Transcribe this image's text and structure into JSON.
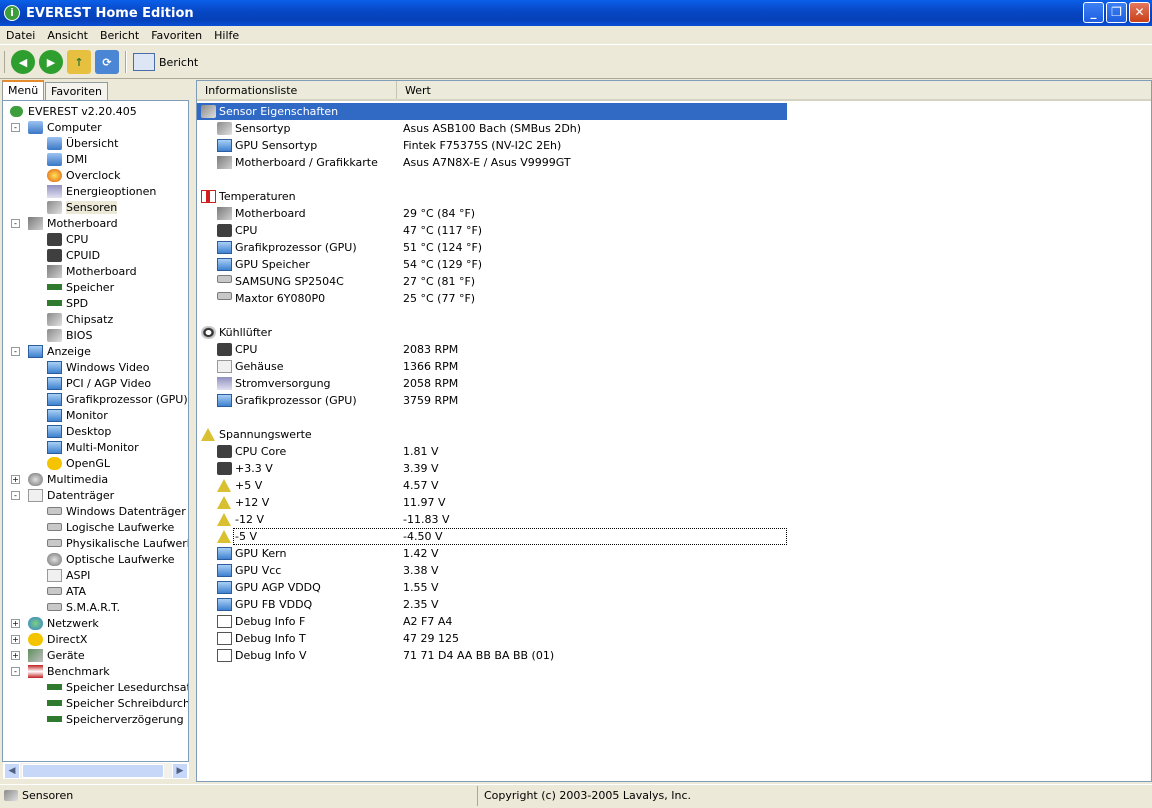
{
  "window": {
    "title": "EVEREST Home Edition"
  },
  "menu": [
    "Datei",
    "Ansicht",
    "Bericht",
    "Favoriten",
    "Hilfe"
  ],
  "toolbar": {
    "report_label": "Bericht"
  },
  "tabs": {
    "menu": "Menü",
    "favorites": "Favoriten"
  },
  "tree": [
    {
      "label": "EVEREST v2.20.405",
      "icon": "everest-icon",
      "level": 0
    },
    {
      "label": "Computer",
      "icon": "computer-icon",
      "level": 1,
      "expander": "-"
    },
    {
      "label": "Übersicht",
      "icon": "computer-icon",
      "level": 2
    },
    {
      "label": "DMI",
      "icon": "computer-icon",
      "level": 2
    },
    {
      "label": "Overclock",
      "icon": "fire-icon",
      "level": 2
    },
    {
      "label": "Energieoptionen",
      "icon": "power-icon",
      "level": 2
    },
    {
      "label": "Sensoren",
      "icon": "sensor-icon",
      "level": 2,
      "selected": true
    },
    {
      "label": "Motherboard",
      "icon": "motherboard-icon",
      "level": 1,
      "expander": "-"
    },
    {
      "label": "CPU",
      "icon": "cpu-icon",
      "level": 2
    },
    {
      "label": "CPUID",
      "icon": "cpu-icon",
      "level": 2
    },
    {
      "label": "Motherboard",
      "icon": "motherboard-icon",
      "level": 2
    },
    {
      "label": "Speicher",
      "icon": "memory-icon",
      "level": 2
    },
    {
      "label": "SPD",
      "icon": "memory-icon",
      "level": 2
    },
    {
      "label": "Chipsatz",
      "icon": "chipset-icon",
      "level": 2
    },
    {
      "label": "BIOS",
      "icon": "chipset-icon",
      "level": 2
    },
    {
      "label": "Anzeige",
      "icon": "monitor-icon",
      "level": 1,
      "expander": "-"
    },
    {
      "label": "Windows Video",
      "icon": "monitor-icon",
      "level": 2
    },
    {
      "label": "PCI / AGP Video",
      "icon": "monitor-icon",
      "level": 2
    },
    {
      "label": "Grafikprozessor (GPU)",
      "icon": "monitor-icon",
      "level": 2
    },
    {
      "label": "Monitor",
      "icon": "monitor-icon",
      "level": 2
    },
    {
      "label": "Desktop",
      "icon": "desktop-icon",
      "level": 2
    },
    {
      "label": "Multi-Monitor",
      "icon": "monitor-icon",
      "level": 2
    },
    {
      "label": "OpenGL",
      "icon": "opengl-icon",
      "level": 2
    },
    {
      "label": "Multimedia",
      "icon": "multimedia-icon",
      "level": 1,
      "expander": "+"
    },
    {
      "label": "Datenträger",
      "icon": "storage-icon",
      "level": 1,
      "expander": "-"
    },
    {
      "label": "Windows Datenträger",
      "icon": "disk-icon",
      "level": 2
    },
    {
      "label": "Logische Laufwerke",
      "icon": "disk-icon",
      "level": 2
    },
    {
      "label": "Physikalische Laufwerke",
      "icon": "disk-icon",
      "level": 2
    },
    {
      "label": "Optische Laufwerke",
      "icon": "optical-icon",
      "level": 2
    },
    {
      "label": "ASPI",
      "icon": "aspi-icon",
      "level": 2
    },
    {
      "label": "ATA",
      "icon": "disk-icon",
      "level": 2
    },
    {
      "label": "S.M.A.R.T.",
      "icon": "disk-icon",
      "level": 2
    },
    {
      "label": "Netzwerk",
      "icon": "network-icon",
      "level": 1,
      "expander": "+"
    },
    {
      "label": "DirectX",
      "icon": "directx-icon",
      "level": 1,
      "expander": "+"
    },
    {
      "label": "Geräte",
      "icon": "devices-icon",
      "level": 1,
      "expander": "+"
    },
    {
      "label": "Benchmark",
      "icon": "hourglass-icon",
      "level": 1,
      "expander": "-"
    },
    {
      "label": "Speicher Lesedurchsatz",
      "icon": "memory-icon",
      "level": 2
    },
    {
      "label": "Speicher Schreibdurchsat",
      "icon": "memory-icon",
      "level": 2
    },
    {
      "label": "Speicherverzögerung",
      "icon": "memory-icon",
      "level": 2
    }
  ],
  "list": {
    "columns": [
      "Informationsliste",
      "Wert"
    ],
    "rows": [
      {
        "label": "Sensor Eigenschaften",
        "value": "",
        "icon": "sensor-icon",
        "group": true,
        "highlight": true
      },
      {
        "label": "Sensortyp",
        "value": "Asus ASB100 Bach  (SMBus 2Dh)",
        "icon": "sensor-icon"
      },
      {
        "label": "GPU Sensortyp",
        "value": "Fintek F75375S  (NV-I2C 2Eh)",
        "icon": "monitor-icon"
      },
      {
        "label": "Motherboard / Grafikkarte",
        "value": "Asus A7N8X-E / Asus V9999GT",
        "icon": "motherboard-icon"
      },
      {
        "label": "",
        "value": "",
        "spacer": true
      },
      {
        "label": "Temperaturen",
        "value": "",
        "icon": "thermometer-icon",
        "group": true
      },
      {
        "label": "Motherboard",
        "value": "29 °C  (84 °F)",
        "icon": "motherboard-icon"
      },
      {
        "label": "CPU",
        "value": "47 °C  (117 °F)",
        "icon": "cpu-icon"
      },
      {
        "label": "Grafikprozessor (GPU)",
        "value": "51 °C  (124 °F)",
        "icon": "monitor-icon"
      },
      {
        "label": "GPU Speicher",
        "value": "54 °C  (129 °F)",
        "icon": "monitor-icon"
      },
      {
        "label": "SAMSUNG SP2504C",
        "value": "27 °C  (81 °F)",
        "icon": "disk-icon"
      },
      {
        "label": "Maxtor 6Y080P0",
        "value": "25 °C  (77 °F)",
        "icon": "disk-icon"
      },
      {
        "label": "",
        "value": "",
        "spacer": true
      },
      {
        "label": "Kühllüfter",
        "value": "",
        "icon": "fan-icon",
        "group": true
      },
      {
        "label": "CPU",
        "value": "2083 RPM",
        "icon": "cpu-icon"
      },
      {
        "label": "Gehäuse",
        "value": "1366 RPM",
        "icon": "case-icon"
      },
      {
        "label": "Stromversorgung",
        "value": "2058 RPM",
        "icon": "power-icon"
      },
      {
        "label": "Grafikprozessor (GPU)",
        "value": "3759 RPM",
        "icon": "monitor-icon"
      },
      {
        "label": "",
        "value": "",
        "spacer": true
      },
      {
        "label": "Spannungswerte",
        "value": "",
        "icon": "voltage-icon",
        "group": true
      },
      {
        "label": "CPU Core",
        "value": "1.81 V",
        "icon": "cpu-icon"
      },
      {
        "label": "+3.3 V",
        "value": "3.39 V",
        "icon": "cpu-icon"
      },
      {
        "label": "+5 V",
        "value": "4.57 V",
        "icon": "voltage-icon"
      },
      {
        "label": "+12 V",
        "value": "11.97 V",
        "icon": "voltage-icon"
      },
      {
        "label": "-12 V",
        "value": "-11.83 V",
        "icon": "voltage-icon"
      },
      {
        "label": "-5 V",
        "value": "-4.50 V",
        "icon": "voltage-icon",
        "focus": true
      },
      {
        "label": "GPU Kern",
        "value": "1.42 V",
        "icon": "monitor-icon"
      },
      {
        "label": "GPU Vcc",
        "value": "3.38 V",
        "icon": "monitor-icon"
      },
      {
        "label": "GPU AGP VDDQ",
        "value": "1.55 V",
        "icon": "monitor-icon"
      },
      {
        "label": "GPU FB VDDQ",
        "value": "2.35 V",
        "icon": "monitor-icon"
      },
      {
        "label": "Debug Info F",
        "value": "A2 F7 A4",
        "icon": "debug-icon"
      },
      {
        "label": "Debug Info T",
        "value": "47 29 125",
        "icon": "debug-icon"
      },
      {
        "label": "Debug Info V",
        "value": "71 71 D4 AA BB BA BB (01)",
        "icon": "debug-icon"
      }
    ]
  },
  "status": {
    "left": "Sensoren",
    "right": "Copyright (c) 2003-2005 Lavalys, Inc."
  }
}
